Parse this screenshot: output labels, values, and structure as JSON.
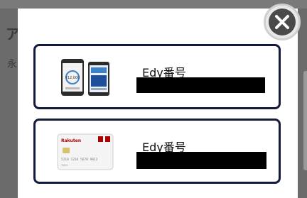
{
  "background": {
    "heading_fragment": "ア",
    "text_fragment": "永"
  },
  "modal": {
    "cards": [
      {
        "label": "Edy番号",
        "image": "smartphone-wallet-icon"
      },
      {
        "label": "Edy番号",
        "image": "rakuten-edy-card-icon"
      }
    ],
    "card_brand": "Rakuten",
    "card_number_preview": "5210 1234 5678 9012"
  },
  "close": {
    "icon": "close-icon"
  },
  "colors": {
    "card_border": "#121a3e",
    "overlay": "#6b6b6b",
    "close": "#4a4a4a"
  }
}
